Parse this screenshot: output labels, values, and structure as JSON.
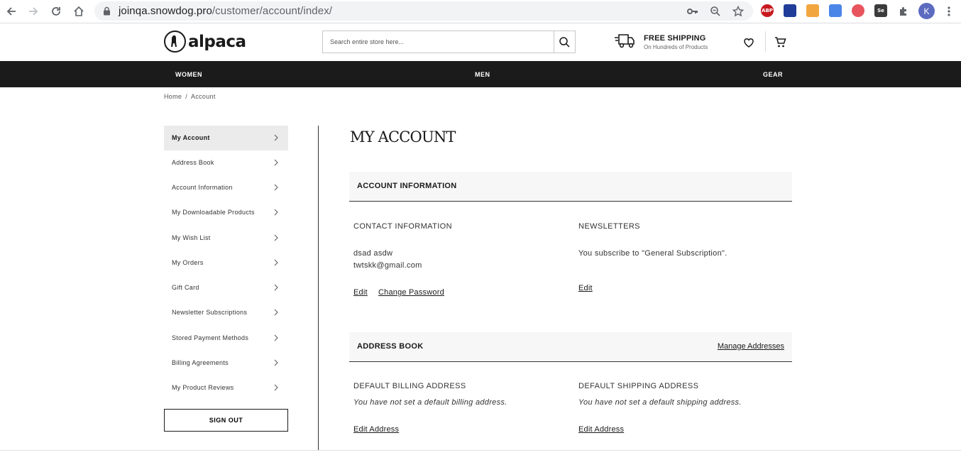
{
  "browser": {
    "url_host": "joinqa.snowdog.pro",
    "url_path": "/customer/account/index/",
    "profile_initial": "K",
    "extensions": [
      {
        "name": "adblock-plus-icon",
        "label": "ABP",
        "color": "#c7191f"
      },
      {
        "name": "news-extension-icon",
        "label": "",
        "color": "#1f3d99"
      },
      {
        "name": "mail-extension-icon",
        "label": "",
        "color": "#f2a640"
      },
      {
        "name": "translate-extension-icon",
        "label": "",
        "color": "#4a86e8"
      },
      {
        "name": "shield-extension-icon",
        "label": "",
        "color": "#e8545d"
      },
      {
        "name": "selenium-extension-icon",
        "label": "Se",
        "color": "#3b3b3b"
      }
    ]
  },
  "header": {
    "logo_text": "alpaca",
    "search_placeholder": "Search entire store here...",
    "shipping_title": "FREE SHIPPING",
    "shipping_subtitle": "On Hundreds of Products"
  },
  "nav": {
    "items": [
      "WOMEN",
      "MEN",
      "GEAR"
    ]
  },
  "breadcrumb": {
    "home": "Home",
    "separator": "/",
    "current": "Account"
  },
  "sidebar": {
    "items": [
      {
        "label": "My Account",
        "active": true
      },
      {
        "label": "Address Book",
        "active": false
      },
      {
        "label": "Account Information",
        "active": false
      },
      {
        "label": "My Downloadable Products",
        "active": false
      },
      {
        "label": "My Wish List",
        "active": false
      },
      {
        "label": "My Orders",
        "active": false
      },
      {
        "label": "Gift Card",
        "active": false
      },
      {
        "label": "Newsletter Subscriptions",
        "active": false
      },
      {
        "label": "Stored Payment Methods",
        "active": false
      },
      {
        "label": "Billing Agreements",
        "active": false
      },
      {
        "label": "My Product Reviews",
        "active": false
      }
    ],
    "sign_out": "SIGN OUT"
  },
  "main": {
    "title": "MY ACCOUNT",
    "account_info": {
      "heading": "ACCOUNT INFORMATION",
      "contact_label": "CONTACT INFORMATION",
      "name": "dsad asdw",
      "email": "twtskk@gmail.com",
      "edit": "Edit",
      "change_password": "Change Password",
      "newsletters_label": "NEWSLETTERS",
      "newsletters_text": "You subscribe to \"General Subscription\".",
      "newsletters_edit": "Edit"
    },
    "address_book": {
      "heading": "ADDRESS BOOK",
      "manage": "Manage Addresses",
      "billing_label": "DEFAULT BILLING ADDRESS",
      "billing_text": "You have not set a default billing address.",
      "billing_edit": "Edit Address",
      "shipping_label": "DEFAULT SHIPPING ADDRESS",
      "shipping_text": "You have not set a default shipping address.",
      "shipping_edit": "Edit Address"
    }
  }
}
